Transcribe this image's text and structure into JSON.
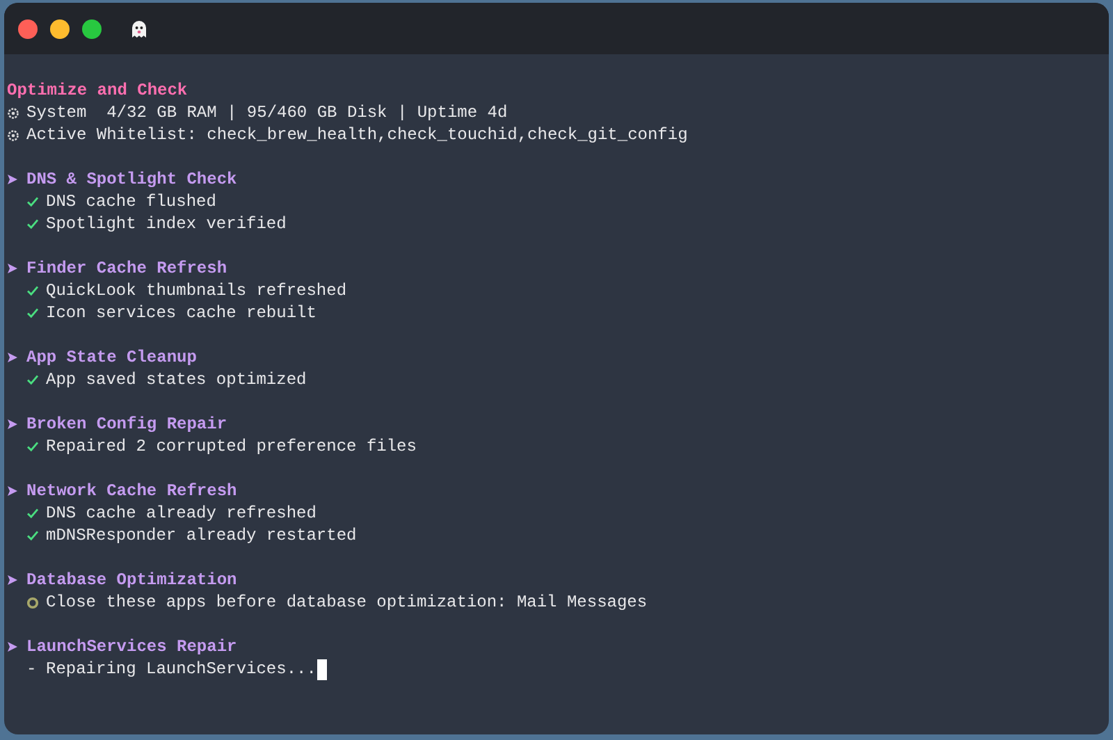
{
  "title": "Optimize and Check",
  "info_lines": [
    "System  4/32 GB RAM | 95/460 GB Disk | Uptime 4d",
    "Active Whitelist: check_brew_health,check_touchid,check_git_config"
  ],
  "sections": [
    {
      "heading": "DNS & Spotlight Check",
      "lines": [
        {
          "kind": "ok",
          "text": "DNS cache flushed"
        },
        {
          "kind": "ok",
          "text": "Spotlight index verified"
        }
      ]
    },
    {
      "heading": "Finder Cache Refresh",
      "lines": [
        {
          "kind": "ok",
          "text": "QuickLook thumbnails refreshed"
        },
        {
          "kind": "ok",
          "text": "Icon services cache rebuilt"
        }
      ]
    },
    {
      "heading": "App State Cleanup",
      "lines": [
        {
          "kind": "ok",
          "text": "App saved states optimized"
        }
      ]
    },
    {
      "heading": "Broken Config Repair",
      "lines": [
        {
          "kind": "ok",
          "text": "Repaired 2 corrupted preference files"
        }
      ]
    },
    {
      "heading": "Network Cache Refresh",
      "lines": [
        {
          "kind": "ok",
          "text": "DNS cache already refreshed"
        },
        {
          "kind": "ok",
          "text": "mDNSResponder already restarted"
        }
      ]
    },
    {
      "heading": "Database Optimization",
      "lines": [
        {
          "kind": "warn",
          "text": "Close these apps before database optimization: Mail Messages"
        }
      ]
    },
    {
      "heading": "LaunchServices Repair",
      "lines": [
        {
          "kind": "pending",
          "marker": "-",
          "text": "Repairing LaunchServices..."
        }
      ]
    }
  ]
}
